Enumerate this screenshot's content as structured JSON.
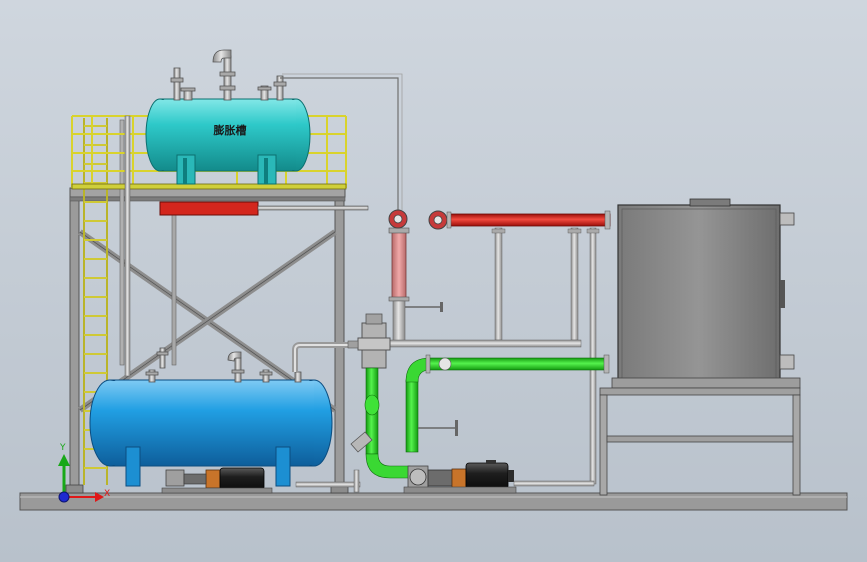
{
  "viewport": {
    "background_top": "#cfd6de",
    "background_bottom": "#b8c1cb"
  },
  "model": {
    "upper_tank_label": "膨胀槽",
    "colors": {
      "tank_upper": "#27c2c2",
      "tank_lower": "#1e9be0",
      "hot_pipe": "#e0241b",
      "return_pipe": "#22d51c",
      "frame": "#8f8f8f",
      "railing": "#e8e23a",
      "heater_body": "#8c8c8c",
      "motor": "#2b2b2b",
      "pump_accent": "#c8742a"
    }
  },
  "triad": {
    "y_label": "Y",
    "x_label": "X",
    "x_color": "#e01818",
    "y_color": "#18a818",
    "z_color": "#1e2ad0"
  }
}
